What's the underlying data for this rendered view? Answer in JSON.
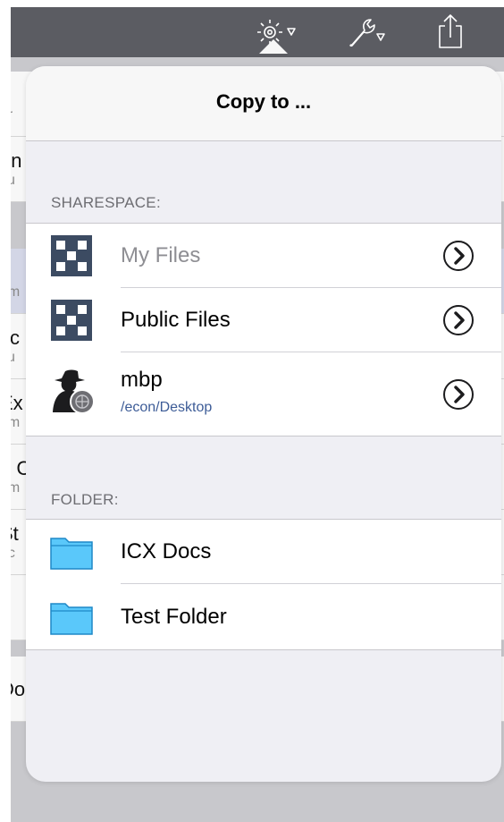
{
  "background_list": [
    {
      "title": "e",
      "subtitle": "ur"
    },
    {
      "title": "on",
      "subtitle": "cu"
    },
    {
      "title": "o",
      "subtitle": "um"
    },
    {
      "title": "xc",
      "subtitle": "cu"
    },
    {
      "title": "Ex",
      "subtitle": "um"
    },
    {
      "title": "n C",
      "subtitle": "um"
    },
    {
      "title": "St",
      "subtitle": "oc"
    },
    {
      "title": "",
      "subtitle": ""
    },
    {
      "title": "Do",
      "subtitle": ""
    }
  ],
  "toolbar": {
    "icons": [
      "gear-dropdown-icon",
      "wrench-dropdown-icon",
      "share-icon"
    ]
  },
  "popover": {
    "title": "Copy to ...",
    "sharespace": {
      "header": "SHARESPACE:",
      "items": [
        {
          "label": "My Files",
          "icon": "sharespace-icon",
          "disabled": true
        },
        {
          "label": "Public Files",
          "icon": "sharespace-icon"
        },
        {
          "label": "mbp",
          "subtitle": "/econ/Desktop",
          "icon": "user-computer-icon"
        }
      ]
    },
    "folder": {
      "header": "FOLDER:",
      "items": [
        {
          "label": "ICX Docs",
          "icon": "folder-icon"
        },
        {
          "label": "Test Folder",
          "icon": "folder-icon"
        }
      ]
    }
  },
  "colors": {
    "toolbar": "#5b5c62",
    "popover_bg": "#efeff4",
    "group_bg": "#ffffff",
    "subtitle": "#3d5c97",
    "folder": "#5ac8fa"
  }
}
